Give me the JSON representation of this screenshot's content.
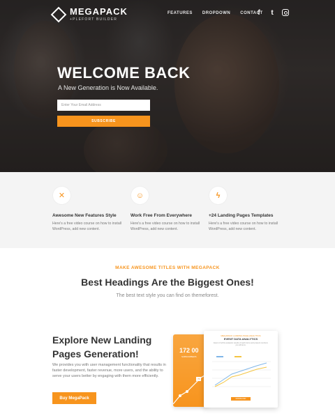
{
  "header": {
    "logo_title": "MEGAPACK",
    "logo_subtitle": "+PLEFORT BUILDER",
    "nav": [
      "FEATURES",
      "DROPDOWN",
      "CONTACT"
    ],
    "social_icons": [
      "facebook-icon",
      "twitter-icon",
      "instagram-icon"
    ],
    "facebook_glyph": "f",
    "twitter_glyph": "t"
  },
  "hero": {
    "title": "WELCOME BACK",
    "subtitle": "A New Generation is Now Available.",
    "email_placeholder": "Enter Your Email Address",
    "subscribe_label": "SUBSCRIBE"
  },
  "features": [
    {
      "icon": "tools-icon",
      "glyph": "✕",
      "title": "Awesome New Features Style",
      "text": "Here's a free video course on how to install WordPress, add new content."
    },
    {
      "icon": "smile-icon",
      "glyph": "☺",
      "title": "Work Free From Everywhere",
      "text": "Here's a free video course on how to install WordPress, add new content."
    },
    {
      "icon": "lightning-icon",
      "glyph": "ϟ",
      "title": "+24 Landing Pages Templates",
      "text": "Here's a free video course on how to install WordPress, add new content."
    }
  ],
  "headings": {
    "kicker": "MAKE AWESOME TITLES WITH MEGAPACK",
    "title": "Best Headings Are the Biggest Ones!",
    "subtitle": "The best text style you can find on themeforest."
  },
  "explore": {
    "title": "Explore New Landing Pages Generation!",
    "text": "We provides you with user management functionality that results in faster development, faster revenue, more users, and the ability to serve your users better by engaging with them more efficiently.",
    "button_label": "Buy MegaPack"
  },
  "mockup": {
    "phone_number": "172 00",
    "phone_label": "SUBSCRIBERS",
    "phone_badge": "75",
    "analytics_kicker": "MEGAPACK LANDING PAGE ANALYTICS",
    "analytics_title": "EVENT DATA ANALYTICS",
    "analytics_desc": "Event of all the analytics results of each items and present numbers you all items.",
    "analytics_button": "DOWNLOAD",
    "colors": {
      "accent": "#f7941d",
      "series_a": "#7fb6e8",
      "series_b": "#f4c542"
    }
  },
  "colors": {
    "accent": "#f7941d",
    "text_dark": "#333333",
    "text_muted": "#777777",
    "features_bg": "#f4f4f4"
  }
}
